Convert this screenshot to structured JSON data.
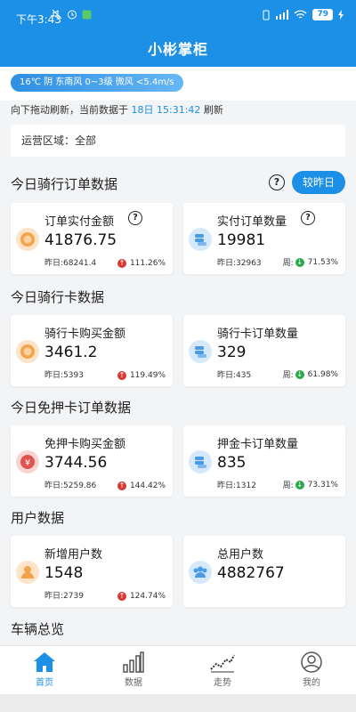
{
  "status_bar": {
    "time": "下午3:43",
    "battery": "79"
  },
  "app": {
    "title": "小彬掌柜"
  },
  "weather": {
    "text": "16℃ 阴 东南风 0~3级 微风 <5.4m/s"
  },
  "refresh": {
    "prefix": "向下拖动刷新，当前数据于",
    "timestamp": "18日 15:31:42",
    "suffix": "刷新"
  },
  "region": {
    "text": "运营区域：全部"
  },
  "sections": {
    "riding_orders": "今日骑行订单数据",
    "riding_cards": "今日骑行卡数据",
    "deposit_free": "今日免押卡订单数据",
    "users": "用户数据",
    "vehicles": "车辆总览"
  },
  "help_glyph": "?",
  "compare_button": "较昨日",
  "cards": [
    {
      "label": "订单实付金额",
      "value": "41876.75",
      "foot": "昨日:68241.4",
      "trend": "111.26%",
      "dir": "up",
      "icon": "coin-icon"
    },
    {
      "label": "实付订单数量",
      "value": "19981",
      "foot": "昨日:32963",
      "trend_prefix": "周:",
      "trend": "71.53%",
      "dir": "down",
      "icon": "stack-icon"
    },
    {
      "label": "骑行卡购买金额",
      "value": "3461.2",
      "foot": "昨日:5393",
      "trend": "119.49%",
      "dir": "up",
      "icon": "coin-icon"
    },
    {
      "label": "骑行卡订单数量",
      "value": "329",
      "foot": "昨日:435",
      "trend_prefix": "周:",
      "trend": "61.98%",
      "dir": "down",
      "icon": "stack-icon"
    },
    {
      "label": "免押卡购买金额",
      "value": "3744.56",
      "foot": "昨日:5259.86",
      "trend": "144.42%",
      "dir": "up",
      "icon": "yen-icon"
    },
    {
      "label": "押金卡订单数量",
      "value": "835",
      "foot": "昨日:1312",
      "trend_prefix": "周:",
      "trend": "73.31%",
      "dir": "down",
      "icon": "stack-icon"
    },
    {
      "label": "新增用户数",
      "value": "1548",
      "foot": "昨日:2739",
      "trend": "124.74%",
      "dir": "up",
      "icon": "user-icon"
    },
    {
      "label": "总用户数",
      "value": "4882767",
      "icon": "users-icon"
    }
  ],
  "tabs": [
    {
      "label": "首页",
      "icon": "home-icon"
    },
    {
      "label": "数据",
      "icon": "bar-chart-icon"
    },
    {
      "label": "走势",
      "icon": "trend-icon"
    },
    {
      "label": "我的",
      "icon": "profile-icon"
    }
  ],
  "colors": {
    "primary": "#1c8fe6",
    "up": "#d63a34",
    "down": "#2aa84a"
  }
}
